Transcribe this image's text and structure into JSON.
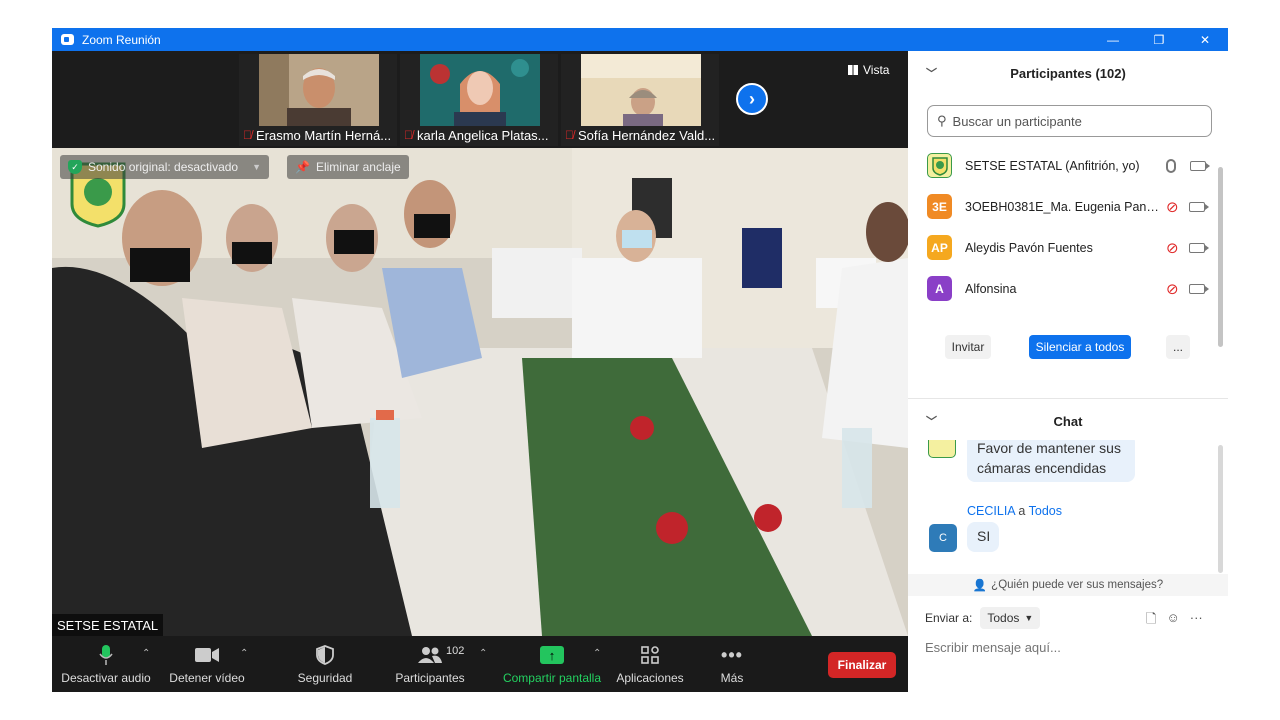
{
  "window": {
    "title": "Zoom Reunión",
    "controls": {
      "minimize": "—",
      "restore": "❐",
      "close": "✕"
    }
  },
  "video": {
    "view_button": "Vista",
    "thumbnails": [
      {
        "name": "Erasmo Martín Herná..."
      },
      {
        "name": "karla Angelica  Platas..."
      },
      {
        "name": "Sofía Hernández Vald..."
      }
    ],
    "original_sound": "Sonido original: desactivado",
    "unpin": "Eliminar anclaje",
    "speaker_name": "SETSE ESTATAL"
  },
  "toolbar": {
    "mute_audio": "Desactivar audio",
    "stop_video": "Detener vídeo",
    "security": "Seguridad",
    "participants": "Participantes",
    "participants_count": "102",
    "share_screen": "Compartir pantalla",
    "apps": "Aplicaciones",
    "more": "Más",
    "end": "Finalizar"
  },
  "participants_panel": {
    "title": "Participantes (102)",
    "search_placeholder": "Buscar un participante",
    "list": [
      {
        "initials": "",
        "name": "SETSE ESTATAL (Anfitrión, yo)",
        "color": "#f4f0a0",
        "mic": "on"
      },
      {
        "initials": "3E",
        "name": "3OEBH0381E_Ma. Eugenia Pane...",
        "color": "#f08a24",
        "mic": "off"
      },
      {
        "initials": "AP",
        "name": "Aleydis Pavón Fuentes",
        "color": "#f5a81f",
        "mic": "off"
      },
      {
        "initials": "A",
        "name": "Alfonsina",
        "color": "#8a3fc7",
        "mic": "off"
      }
    ],
    "invite": "Invitar",
    "mute_all": "Silenciar a todos",
    "more": "..."
  },
  "chat": {
    "title": "Chat",
    "messages": [
      {
        "text": "Favor de mantener sus cámaras encendidas"
      },
      {
        "sender": "CECILIA",
        "to_word": "a",
        "recipient": "Todos",
        "avatar": "C",
        "text": "SI"
      }
    ],
    "who_can_see": "¿Quién puede ver sus mensajes?",
    "send_to_label": "Enviar a:",
    "send_to_value": "Todos",
    "input_placeholder": "Escribir mensaje aquí..."
  }
}
